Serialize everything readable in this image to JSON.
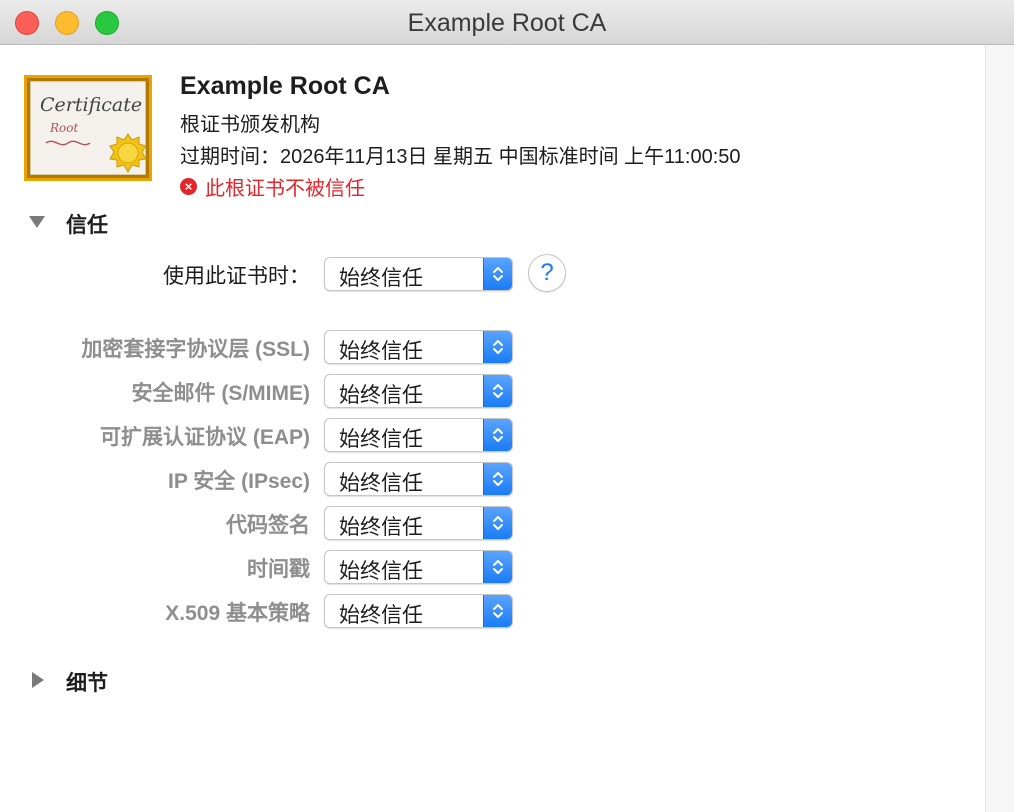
{
  "window": {
    "title": "Example Root CA"
  },
  "certificate": {
    "icon_text": "Certificate",
    "icon_subtext": "Root",
    "name": "Example Root CA",
    "issuer_type": "根证书颁发机构",
    "expiry": "过期时间：2026年11月13日 星期五 中国标准时间 上午11:00:50",
    "warning": "此根证书不被信任",
    "warning_color": "#e4252b"
  },
  "trust": {
    "section_label": "信任",
    "when_using_label": "使用此证书时：",
    "when_using_value": "始终信任",
    "help_label": "?",
    "rows": [
      {
        "label": "加密套接字协议层 (SSL)",
        "value": "始终信任"
      },
      {
        "label": "安全邮件 (S/MIME)",
        "value": "始终信任"
      },
      {
        "label": "可扩展认证协议 (EAP)",
        "value": "始终信任"
      },
      {
        "label": "IP 安全 (IPsec)",
        "value": "始终信任"
      },
      {
        "label": "代码签名",
        "value": "始终信任"
      },
      {
        "label": "时间戳",
        "value": "始终信任"
      },
      {
        "label": "X.509 基本策略",
        "value": "始终信任"
      }
    ]
  },
  "details": {
    "section_label": "细节"
  },
  "colors": {
    "accent": "#1a7cf5",
    "close": "#fc5f57",
    "minimize": "#fdbc2e",
    "maximize": "#28c840"
  }
}
